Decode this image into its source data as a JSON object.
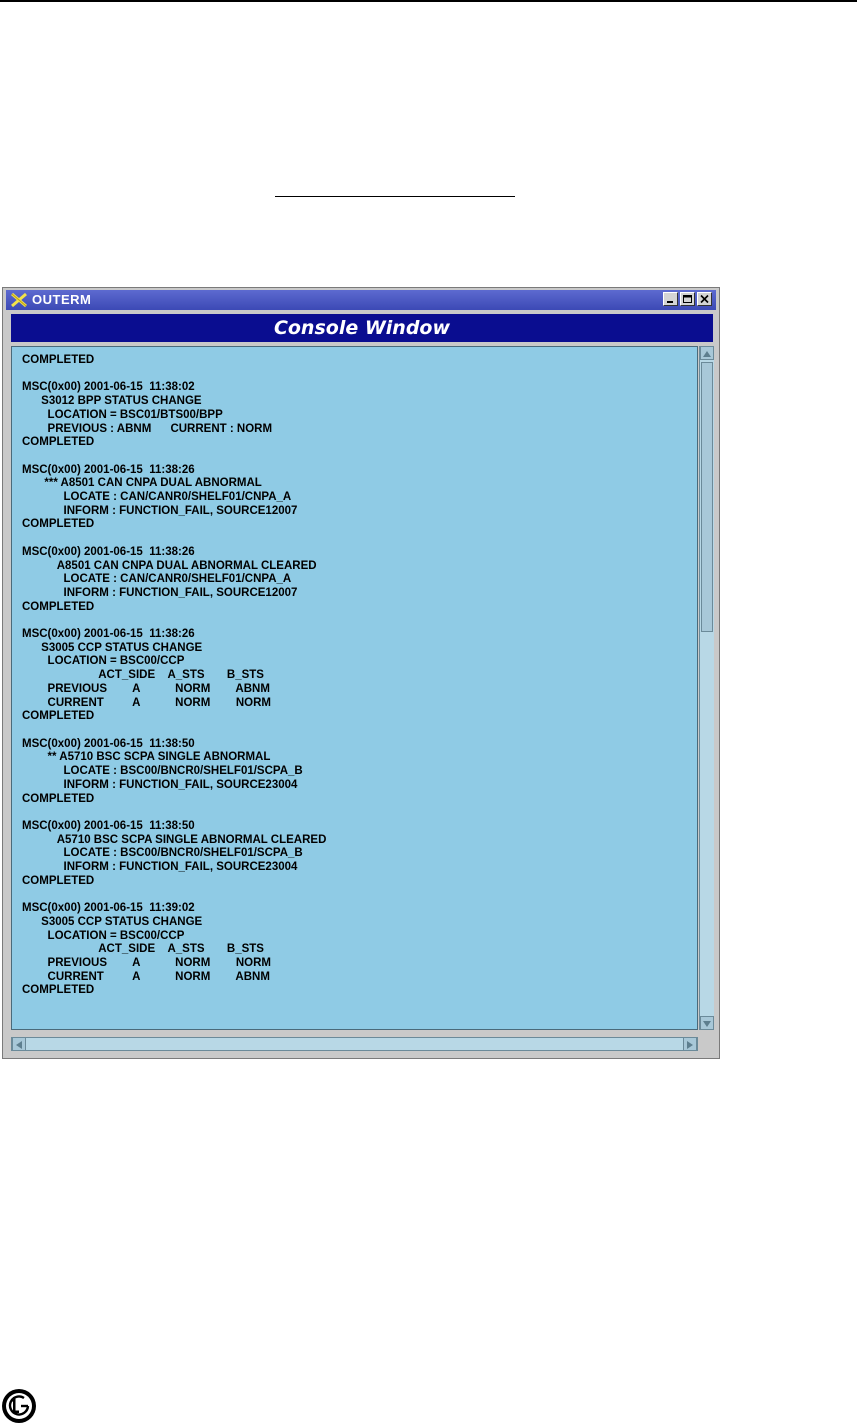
{
  "window": {
    "title": "OUTERM",
    "header": "Console Window"
  },
  "console": {
    "lines": [
      "COMPLETED",
      "",
      "MSC(0x00) 2001-06-15  11:38:02",
      "      S3012 BPP STATUS CHANGE",
      "        LOCATION = BSC01/BTS00/BPP",
      "        PREVIOUS : ABNM      CURRENT : NORM",
      "COMPLETED",
      "",
      "MSC(0x00) 2001-06-15  11:38:26",
      "       *** A8501 CAN CNPA DUAL ABNORMAL",
      "             LOCATE : CAN/CANR0/SHELF01/CNPA_A",
      "             INFORM : FUNCTION_FAIL, SOURCE12007",
      "COMPLETED",
      "",
      "MSC(0x00) 2001-06-15  11:38:26",
      "           A8501 CAN CNPA DUAL ABNORMAL CLEARED",
      "             LOCATE : CAN/CANR0/SHELF01/CNPA_A",
      "             INFORM : FUNCTION_FAIL, SOURCE12007",
      "COMPLETED",
      "",
      "MSC(0x00) 2001-06-15  11:38:26",
      "      S3005 CCP STATUS CHANGE",
      "        LOCATION = BSC00/CCP",
      "                        ACT_SIDE    A_STS       B_STS",
      "        PREVIOUS        A           NORM        ABNM",
      "        CURRENT         A           NORM        NORM",
      "COMPLETED",
      "",
      "MSC(0x00) 2001-06-15  11:38:50",
      "        ** A5710 BSC SCPA SINGLE ABNORMAL",
      "             LOCATE : BSC00/BNCR0/SHELF01/SCPA_B",
      "             INFORM : FUNCTION_FAIL, SOURCE23004",
      "COMPLETED",
      "",
      "MSC(0x00) 2001-06-15  11:38:50",
      "           A5710 BSC SCPA SINGLE ABNORMAL CLEARED",
      "             LOCATE : BSC00/BNCR0/SHELF01/SCPA_B",
      "             INFORM : FUNCTION_FAIL, SOURCE23004",
      "COMPLETED",
      "",
      "MSC(0x00) 2001-06-15  11:39:02",
      "      S3005 CCP STATUS CHANGE",
      "        LOCATION = BSC00/CCP",
      "                        ACT_SIDE    A_STS       B_STS",
      "        PREVIOUS        A           NORM        NORM",
      "        CURRENT         A           NORM        ABNM",
      "COMPLETED"
    ]
  },
  "icons": {
    "app": "x-close-icon",
    "minimize": "minimize-icon",
    "maximize": "maximize-icon",
    "close": "close-icon",
    "logo": "lg-logo"
  },
  "colors": {
    "titlebar": "#3c49b5",
    "header": "#0a0d90",
    "console_bg": "#8fcbe5"
  }
}
